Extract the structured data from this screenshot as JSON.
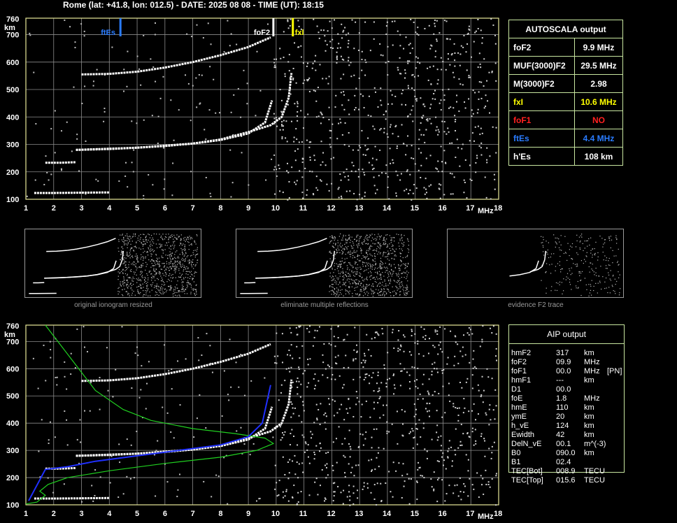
{
  "header": "Rome (lat: +41.8, lon: 012.5) - DATE: 2025 08 08 - TIME (UT): 18:15",
  "colors": {
    "background": "#000000",
    "grid": "#8c8c8c",
    "axes": "#e8e89a",
    "echo": "#ffffff",
    "fxl": "#ffff00",
    "foF1": "#ff2020",
    "ftEs": "#2a7cff",
    "profile": "#20d020",
    "trace": "#2030ff"
  },
  "autoscala": {
    "title": "AUTOSCALA output",
    "rows": [
      {
        "label": "foF2",
        "value": "9.9 MHz",
        "color": "#ffffff"
      },
      {
        "label": "MUF(3000)F2",
        "value": "29.5 MHz",
        "color": "#ffffff"
      },
      {
        "label": "M(3000)F2",
        "value": "2.98",
        "color": "#ffffff"
      },
      {
        "label": "fxI",
        "value": "10.6 MHz",
        "color": "#ffff00"
      },
      {
        "label": "foF1",
        "value": "NO",
        "color": "#ff2020"
      },
      {
        "label": "ftEs",
        "value": "4.4 MHz",
        "color": "#2a7cff"
      },
      {
        "label": "h'Es",
        "value": "108    km",
        "color": "#ffffff"
      }
    ]
  },
  "thumbnails": {
    "captions": [
      "original ionogram resized",
      "eliminate multiple reflections",
      "evidence F2 trace"
    ]
  },
  "aip": {
    "title": "AIP output",
    "rows": [
      {
        "name": "hmF2",
        "value": "317",
        "unit": "km",
        "extra": ""
      },
      {
        "name": "foF2",
        "value": "09.9",
        "unit": "MHz",
        "extra": ""
      },
      {
        "name": "foF1",
        "value": "00.0",
        "unit": "MHz",
        "extra": "[PN]"
      },
      {
        "name": "hmF1",
        "value": "---",
        "unit": "km",
        "extra": ""
      },
      {
        "name": "D1",
        "value": "00.0",
        "unit": "",
        "extra": ""
      },
      {
        "name": "foE",
        "value": "1.8",
        "unit": "MHz",
        "extra": ""
      },
      {
        "name": "hmE",
        "value": "110",
        "unit": "km",
        "extra": ""
      },
      {
        "name": "ymE",
        "value": "20",
        "unit": "km",
        "extra": ""
      },
      {
        "name": "h_vE",
        "value": "124",
        "unit": "km",
        "extra": ""
      },
      {
        "name": "Ewidth",
        "value": "42",
        "unit": "km",
        "extra": ""
      },
      {
        "name": "DelN_vE",
        "value": "00.1",
        "unit": "m^(-3)",
        "extra": ""
      },
      {
        "name": "B0",
        "value": "090.0",
        "unit": "km",
        "extra": ""
      },
      {
        "name": "B1",
        "value": "02.4",
        "unit": "",
        "extra": ""
      },
      {
        "name": "TEC[Bot]",
        "value": "008.9",
        "unit": "TECU",
        "extra": ""
      },
      {
        "name": "TEC[Top]",
        "value": "015.6",
        "unit": "TECU",
        "extra": ""
      }
    ]
  },
  "chart_data": [
    {
      "type": "scatter",
      "xlim": [
        1,
        18
      ],
      "ylim": [
        100,
        760
      ],
      "xticks": [
        1,
        2,
        3,
        4,
        5,
        6,
        7,
        8,
        9,
        10,
        11,
        12,
        13,
        14,
        15,
        16,
        17,
        18
      ],
      "yticks": [
        100,
        200,
        300,
        400,
        500,
        600,
        700
      ],
      "ytop_label": "760",
      "yunit": "km",
      "xunit": "MHz",
      "grid": true,
      "markers": [
        {
          "label": "ftEs",
          "x": 4.4,
          "color": "#2a7cff"
        },
        {
          "label": "foF2",
          "x": 9.9,
          "color": "#ffffff"
        },
        {
          "label": "fxl",
          "x": 10.6,
          "color": "#ffff00"
        }
      ],
      "traces": [
        {
          "name": "",
          "x": [
            2.8,
            4,
            5,
            6,
            7,
            8,
            9,
            9.6,
            9.85
          ],
          "y": [
            280,
            283,
            288,
            294,
            303,
            316,
            340,
            380,
            460
          ]
        },
        {
          "name": "",
          "x": [
            2.8,
            5,
            7,
            8,
            9,
            9.8,
            10.2,
            10.45,
            10.55
          ],
          "y": [
            280,
            288,
            303,
            318,
            345,
            370,
            400,
            470,
            560
          ]
        },
        {
          "name": "",
          "x": [
            3,
            4,
            5,
            6,
            7,
            8,
            9,
            9.8
          ],
          "y": [
            555,
            557,
            565,
            580,
            600,
            625,
            655,
            690
          ]
        },
        {
          "name": "",
          "x": [
            1.3,
            2,
            3,
            4
          ],
          "y": [
            123,
            123,
            124,
            125
          ]
        },
        {
          "name": "",
          "x": [
            1.7,
            2.2,
            2.8
          ],
          "y": [
            233,
            233,
            235
          ]
        }
      ]
    },
    {
      "type": "line",
      "xlim": [
        1,
        18
      ],
      "ylim": [
        100,
        760
      ],
      "xticks": [
        1,
        2,
        3,
        4,
        5,
        6,
        7,
        8,
        9,
        10,
        11,
        12,
        13,
        14,
        15,
        16,
        17,
        18
      ],
      "yticks": [
        100,
        200,
        300,
        400,
        500,
        600,
        700
      ],
      "ytop_label": "760",
      "yunit": "km",
      "xunit": "MHz",
      "grid": true,
      "series": [
        {
          "name": "",
          "color": "#20d020",
          "x": [
            1.0,
            1.4,
            1.7,
            1.5,
            1.8,
            2.5,
            4,
            6,
            8,
            9.3,
            9.9,
            9.6,
            8.5,
            7,
            5.5,
            4.5,
            3.5,
            2.6,
            1.7
          ],
          "y": [
            103,
            110,
            135,
            150,
            175,
            200,
            225,
            252,
            275,
            300,
            325,
            345,
            362,
            380,
            410,
            450,
            520,
            640,
            760
          ]
        },
        {
          "name": "",
          "color": "#2030ff",
          "x": [
            1.1,
            1.7,
            2.5,
            3.5,
            5,
            6.5,
            8,
            9,
            9.5,
            9.8
          ],
          "y": [
            115,
            230,
            240,
            260,
            280,
            300,
            320,
            350,
            400,
            540
          ]
        }
      ]
    }
  ]
}
